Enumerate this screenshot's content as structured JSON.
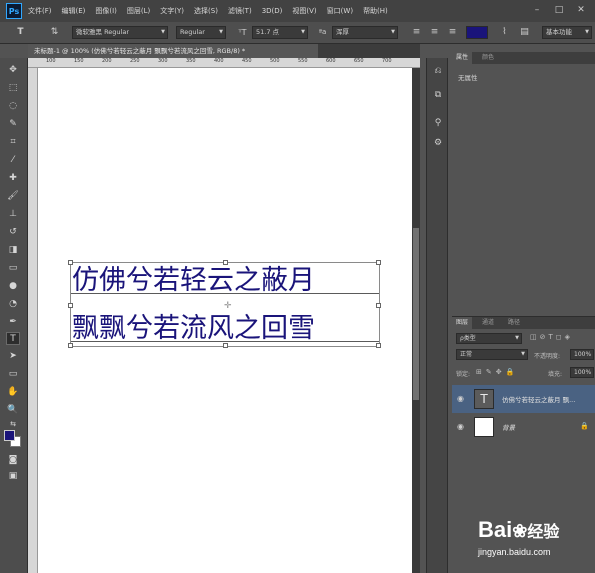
{
  "app": {
    "logo": "Ps"
  },
  "menu": [
    "文件(F)",
    "编辑(E)",
    "图像(I)",
    "图层(L)",
    "文字(Y)",
    "选择(S)",
    "滤镜(T)",
    "3D(D)",
    "视图(V)",
    "窗口(W)",
    "帮助(H)"
  ],
  "options": {
    "font_family": "微软雅黑 Regular",
    "font_style": "Regular",
    "font_size": "51.7 点",
    "antialias": "浑厚",
    "workspace": "基本功能",
    "text_color": "#1a147a"
  },
  "document": {
    "tab_title": "未标题-1 @ 100% (仿佛兮若轻云之蔽月 飘飘兮若流风之回雪, RGB/8) *"
  },
  "ruler_ticks": [
    "100",
    "150",
    "200",
    "250",
    "300",
    "350",
    "400",
    "450",
    "500",
    "550",
    "600",
    "650",
    "700"
  ],
  "canvas": {
    "line1": "仿佛兮若轻云之蔽月",
    "line2": "飘飘兮若流风之回雪"
  },
  "properties": {
    "tabs": [
      "属性",
      "颜色"
    ],
    "body": "无属性"
  },
  "layers": {
    "tabs": [
      "图层",
      "通道",
      "路径"
    ],
    "kind_filter": "ρ类型",
    "blend_mode": "正常",
    "opacity_label": "不透明度:",
    "opacity_value": "100%",
    "lock_label": "锁定:",
    "fill_label": "填充:",
    "fill_value": "100%",
    "items": [
      {
        "name": "仿佛兮若轻云之蔽月 飘...",
        "thumb_glyph": "T"
      },
      {
        "name": "背景"
      }
    ]
  },
  "watermark": {
    "brand": "Bai",
    "brand_cn": "经验",
    "url": "jingyan.baidu.com"
  },
  "colors": {
    "foreground": "#1a147a",
    "background": "#ffffff",
    "accent": "#31a8ff"
  }
}
